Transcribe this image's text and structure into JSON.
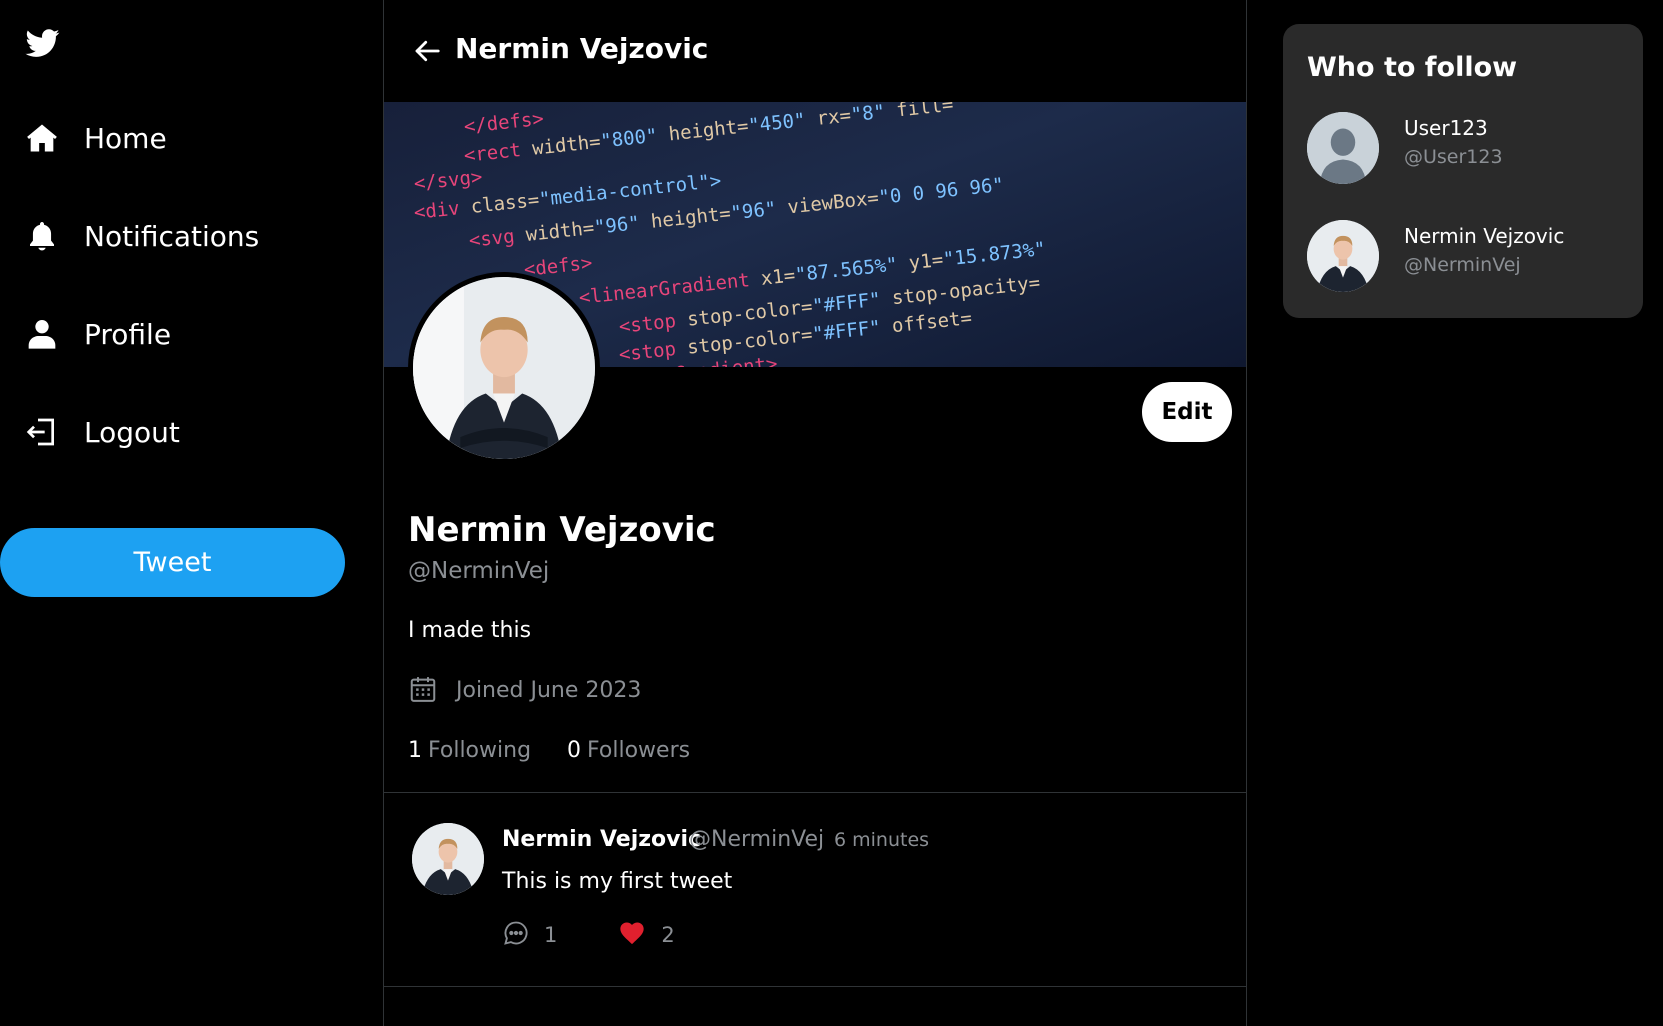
{
  "sidebar": {
    "logo": "twitter-bird-icon",
    "items": [
      {
        "label": "Home",
        "icon": "home-icon"
      },
      {
        "label": "Notifications",
        "icon": "bell-icon"
      },
      {
        "label": "Profile",
        "icon": "user-icon"
      },
      {
        "label": "Logout",
        "icon": "logout-icon"
      }
    ],
    "tweet_button": "Tweet"
  },
  "header": {
    "title": "Nermin Vejzovic",
    "back_icon": "arrow-left-icon"
  },
  "banner": {
    "code_lines": [
      [
        "</defs>",
        "",
        ""
      ],
      [
        "<rect",
        " width=",
        "\"800\"",
        " height=",
        "\"450\"",
        " rx=",
        "\"8\"",
        " fill="
      ],
      [
        "</svg>",
        "",
        ""
      ],
      [
        "<div",
        " class=",
        "\"media-control\">"
      ],
      [
        "<svg",
        " width=",
        "\"96\"",
        " height=",
        "\"96\"",
        " viewBox=",
        "\"0 0 96 96\""
      ],
      [
        "<defs>",
        "",
        ""
      ],
      [
        "<linearGradient",
        " x1=",
        "\"87.565%\"",
        " y1=",
        "\"15.873%\""
      ],
      [
        "<stop",
        " stop-color=",
        "\"#FFF\"",
        " stop-opacity="
      ],
      [
        "<stop",
        " stop-color=",
        "\"#FFF\"",
        " offset="
      ],
      [
        "</linearGradient>",
        "",
        ""
      ]
    ]
  },
  "profile": {
    "name": "Nermin Vejzovic",
    "handle": "@NerminVej",
    "bio": "I made this",
    "joined": "Joined June 2023",
    "following_count": "1",
    "following_label": "Following",
    "followers_count": "0",
    "followers_label": "Followers",
    "edit_label": "Edit"
  },
  "tweets": [
    {
      "name": "Nermin Vejzovic",
      "handle": "@NerminVej",
      "time": "6 minutes",
      "text": "This is my first tweet",
      "replies": "1",
      "likes": "2",
      "liked": true
    }
  ],
  "who_to_follow": {
    "title": "Who to follow",
    "users": [
      {
        "name": "User123",
        "handle": "@User123",
        "avatar": "default-avatar"
      },
      {
        "name": "Nermin Vejzovic",
        "handle": "@NerminVej",
        "avatar": "photo-avatar"
      }
    ]
  },
  "colors": {
    "accent": "#1da1f2",
    "background": "#000000",
    "panel": "#2a2a2a",
    "muted_text": "#8b8f94",
    "like_red": "#f91880"
  }
}
